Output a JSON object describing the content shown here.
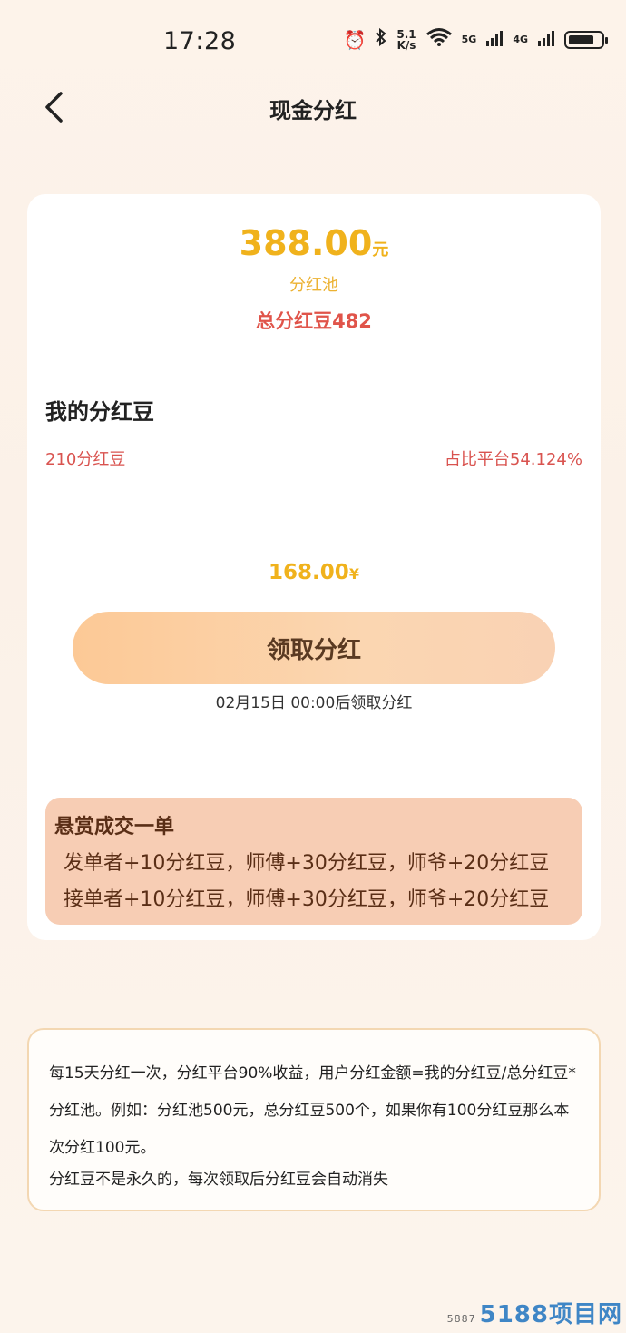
{
  "status_bar": {
    "time": "17:28",
    "net_speed_value": "5.1",
    "net_speed_unit": "K/s",
    "signal_5g": "5G",
    "signal_4g": "4G",
    "battery_level": 0.8
  },
  "nav": {
    "title": "现金分红"
  },
  "pool": {
    "amount": "388.00",
    "unit": "元",
    "label": "分红池",
    "total_beans": "总分红豆482"
  },
  "mine": {
    "title": "我的分红豆",
    "beans": "210分红豆",
    "ratio": "占比平台54.124%",
    "amount": "168.00",
    "unit": "¥",
    "claim_label": "领取分红",
    "claim_time": "02月15日 00:00后领取分红"
  },
  "reward": {
    "title": "悬赏成交一单",
    "line1": "发单者+10分红豆，师傅+30分红豆，师爷+20分红豆",
    "line2": "接单者+10分红豆，师傅+30分红豆，师爷+20分红豆"
  },
  "rules": {
    "p1": "每15天分红一次，分红平台90%收益，用户分红金额=我的分红豆/总分红豆*分红池。例如：分红池500元，总分红豆500个，如果你有100分红豆那么本次分红100元。",
    "p2": "分红豆不是永久的，每次领取后分红豆会自动消失"
  },
  "watermark": {
    "small": "5887",
    "big": "5188项目网"
  },
  "colors": {
    "accent_gold": "#f0b21c",
    "accent_red": "#e0544a",
    "button_start": "#fcc996",
    "reward_bg": "#f7cdb4"
  }
}
